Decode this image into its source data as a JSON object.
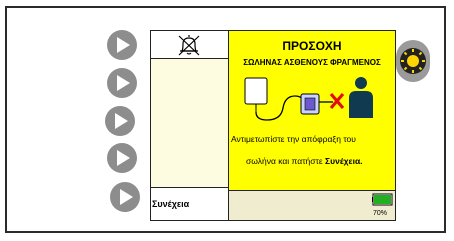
{
  "alert": {
    "title": "ΠΡΟΣΟΧΗ",
    "subtitle": "ΣΩΛΗΝΑΣ ΑΣΘΕΝΟΥΣ ΦΡΑΓΜΕΝΟΣ",
    "message_line1": "Αντιμετωπίστε την απόφραξη του",
    "message_line2_prefix": "σωλήνα και πατήστε ",
    "message_line2_action": "Συνέχεια.",
    "background_color": "#ffff00"
  },
  "left_column": {
    "alarm_icon": "alarm-silenced-bell-icon",
    "continue_label": "Συνέχεια"
  },
  "side_buttons": [
    "play-icon",
    "play-icon",
    "play-icon",
    "play-icon",
    "play-icon"
  ],
  "status": {
    "battery_percent": "70%",
    "battery_level": 0.7,
    "battery_color": "#22b022"
  },
  "light_button": {
    "icon": "sun-icon",
    "color": "#ffd400"
  }
}
